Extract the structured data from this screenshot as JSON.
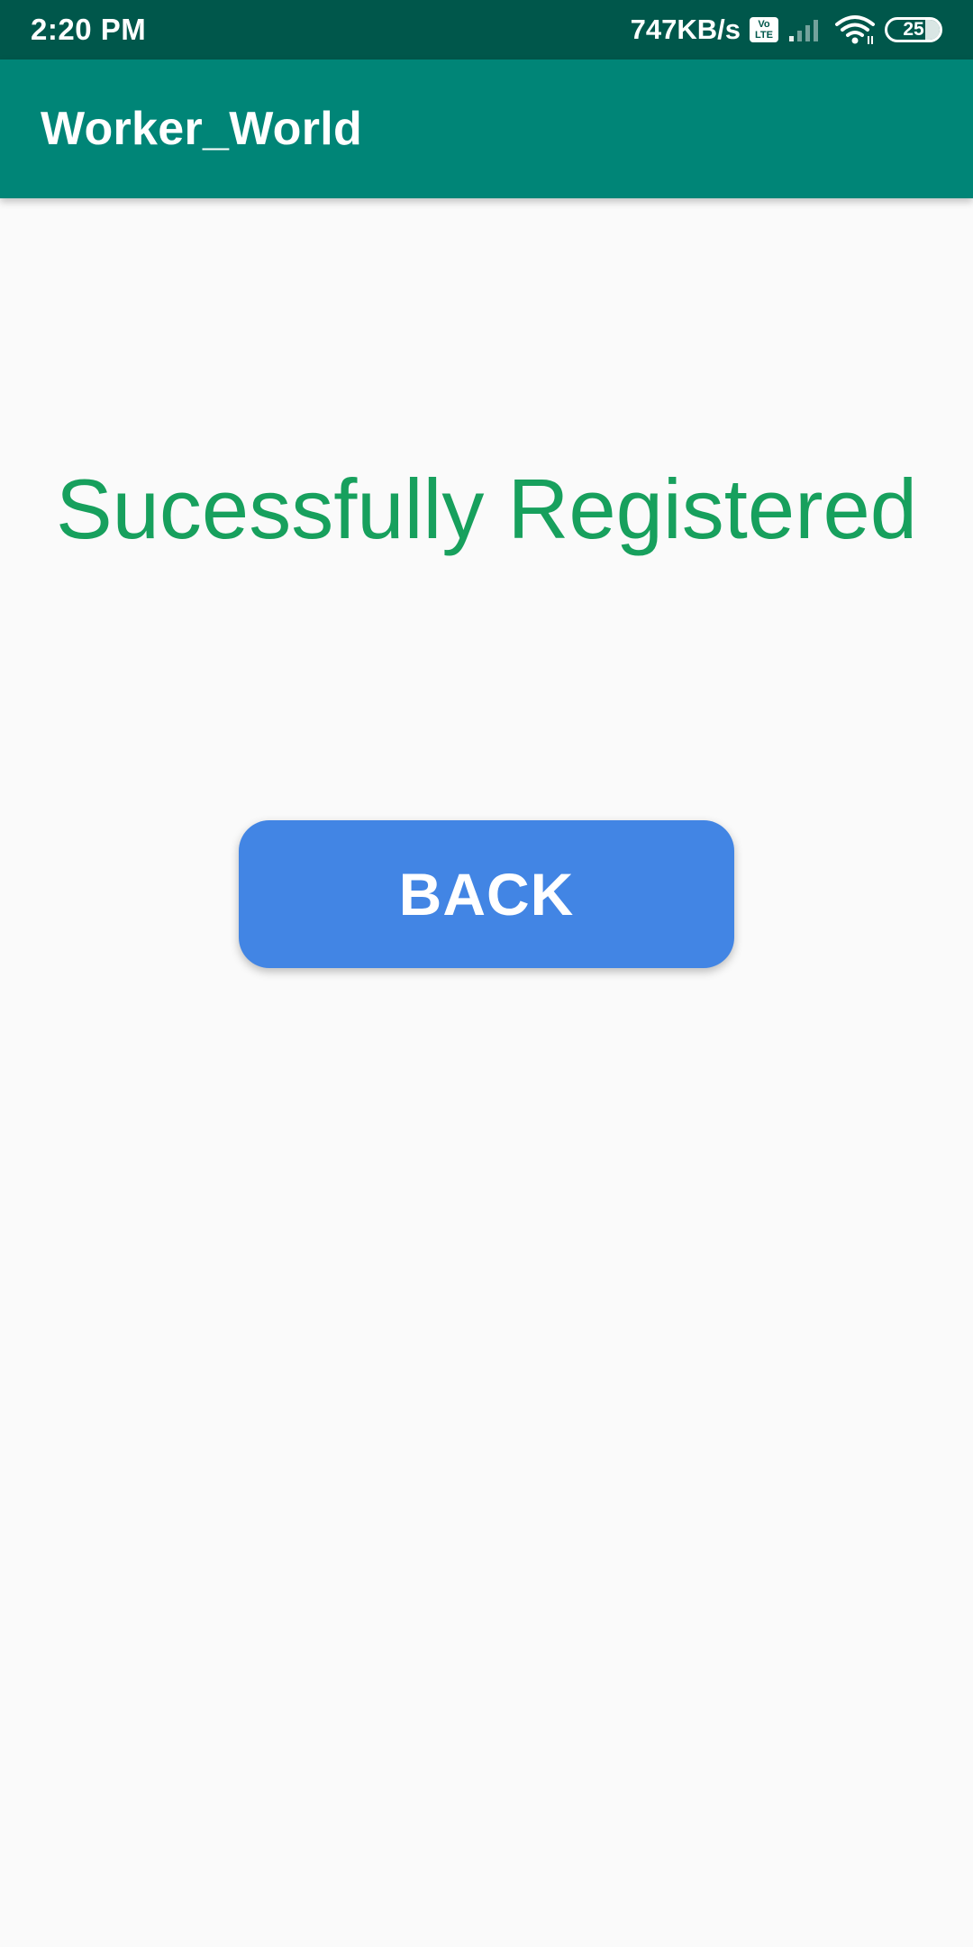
{
  "status_bar": {
    "time": "2:20 PM",
    "net_speed": "747KB/s",
    "volte_top": "Vo",
    "volte_bottom": "LTE",
    "battery_level": "25",
    "icons": [
      "volte-icon",
      "signal-icon",
      "wifi-icon",
      "battery-icon"
    ]
  },
  "app_bar": {
    "title": "Worker_World"
  },
  "main": {
    "message": "Sucessfully Registered",
    "back_label": "BACK"
  },
  "colors": {
    "status_bar": "#00574b",
    "app_bar": "#008577",
    "message": "#17a05d",
    "button": "#4285e4",
    "background": "#fafafa"
  }
}
